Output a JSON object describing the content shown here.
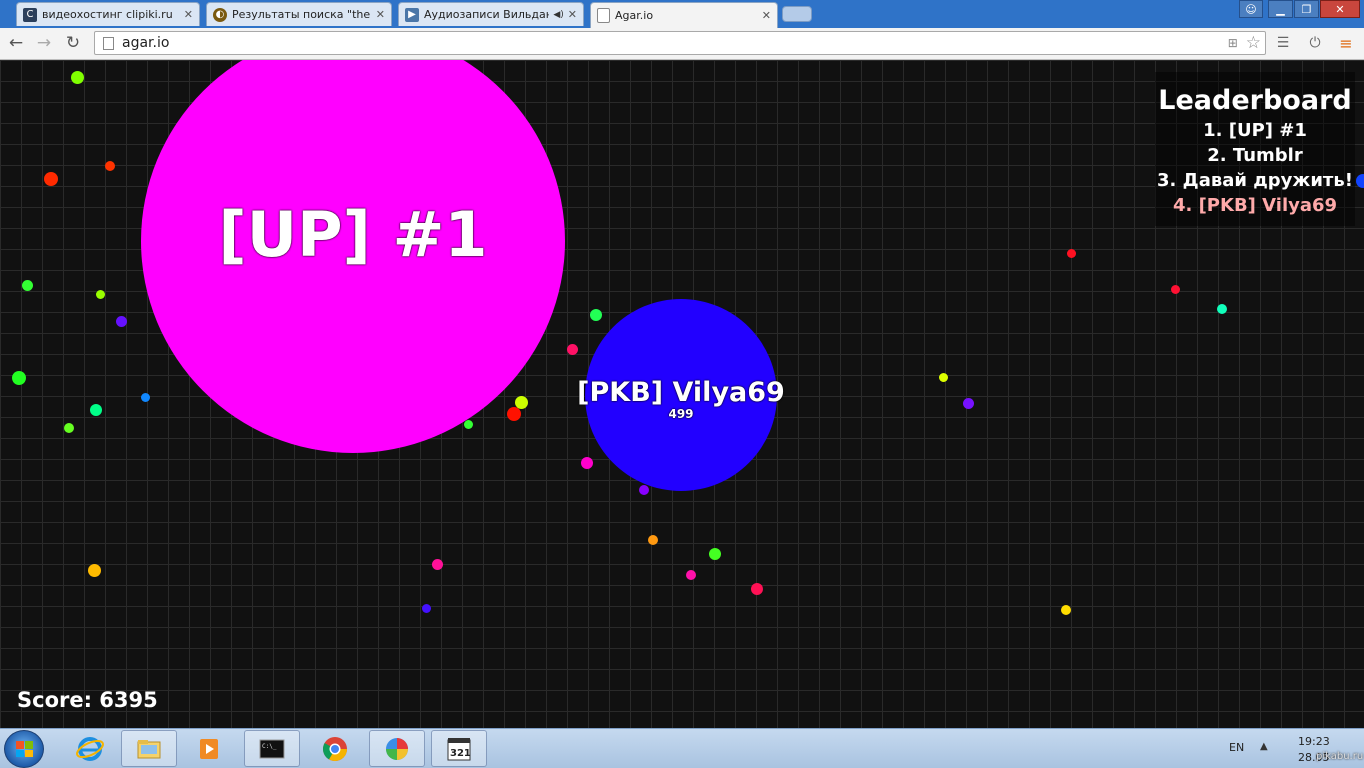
{
  "browser": {
    "tabs": [
      {
        "label": "видеохостинг clipiki.ru",
        "favicon": "clipiki-icon",
        "active": false
      },
      {
        "label": "Результаты поиска \"the b",
        "favicon": "search-results-icon",
        "active": false
      },
      {
        "label": "Аудиозаписи Вильдан",
        "favicon": "vk-audio-icon",
        "active": false,
        "playing_audio": true
      },
      {
        "label": "Agar.io",
        "favicon": "page-icon",
        "active": true
      }
    ],
    "close_glyph": "✕",
    "url": "agar.io"
  },
  "game": {
    "leaderboard": {
      "title": "Leaderboard",
      "entries": [
        "1. [UP] #1",
        "2. Tumblr",
        "3. Давай дружить!",
        "4. [PKB] Vilya69"
      ],
      "highlight_index": 3
    },
    "cells": [
      {
        "name": "[UP] #1",
        "color": "#ff00ff"
      },
      {
        "name": "[PKB] Vilya69",
        "mass": "499",
        "color": "#2200ff"
      }
    ],
    "score_text": "Score: 6395"
  },
  "taskbar": {
    "language": "EN",
    "time": "19:23",
    "date": "28.05",
    "watermark": "pikabu.ru"
  }
}
